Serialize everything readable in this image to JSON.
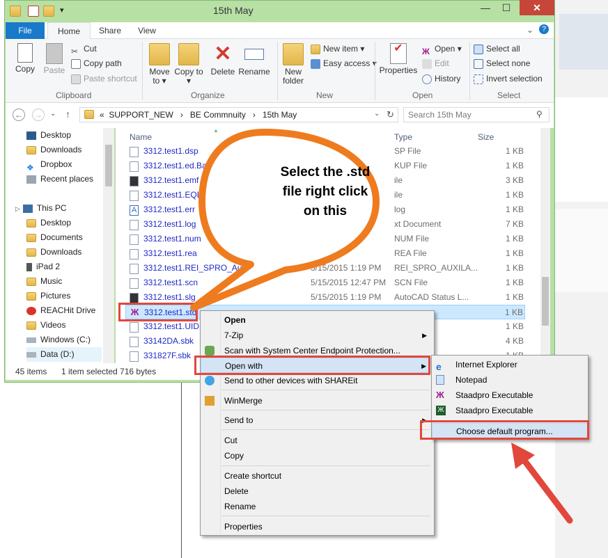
{
  "window": {
    "title": "15th May",
    "minimize": "—",
    "maximize": "☐",
    "close": "✕"
  },
  "ribbon": {
    "tabs": [
      "File",
      "Home",
      "Share",
      "View"
    ],
    "clipboard": {
      "label": "Clipboard",
      "copy": "Copy",
      "paste": "Paste",
      "cut": "Cut",
      "copy_path": "Copy path",
      "paste_shortcut": "Paste shortcut"
    },
    "organize": {
      "label": "Organize",
      "move_to": "Move to ▾",
      "copy_to": "Copy to ▾",
      "delete": "Delete",
      "rename": "Rename"
    },
    "new": {
      "label": "New",
      "new_folder": "New folder",
      "new_item": "New item ▾",
      "easy_access": "Easy access ▾"
    },
    "open": {
      "label": "Open",
      "properties": "Properties",
      "open": "Open ▾",
      "edit": "Edit",
      "history": "History"
    },
    "select": {
      "label": "Select",
      "select_all": "Select all",
      "select_none": "Select none",
      "invert": "Invert selection"
    }
  },
  "address": {
    "crumbs": [
      "«",
      "SUPPORT_NEW",
      "›",
      "BE Commnuity",
      "›",
      "15th May"
    ],
    "search_placeholder": "Search 15th May"
  },
  "nav": {
    "favorites": [
      "Desktop",
      "Downloads",
      "Dropbox",
      "Recent places"
    ],
    "this_pc": "This PC",
    "pc_items": [
      "Desktop",
      "Documents",
      "Downloads",
      "iPad 2",
      "Music",
      "Pictures",
      "REACHit Drive",
      "Videos",
      "Windows (C:)",
      "Data (D:)"
    ]
  },
  "columns": {
    "name": "Name",
    "type": "Type",
    "size": "Size"
  },
  "files": [
    {
      "name": "3312.test1.dsp",
      "date": "",
      "type": "SP File",
      "size": "1 KB"
    },
    {
      "name": "3312.test1.ed.Backup",
      "date": "",
      "type": "KUP File",
      "size": "1 KB"
    },
    {
      "name": "3312.test1.emf",
      "date": "",
      "type": "ile",
      "size": "3 KB"
    },
    {
      "name": "3312.test1.EQL",
      "date": "",
      "type": "ile",
      "size": "1 KB"
    },
    {
      "name": "3312.test1.err",
      "date": "",
      "type": "log",
      "size": "1 KB"
    },
    {
      "name": "3312.test1.log",
      "date": "",
      "type": "xt Document",
      "size": "7 KB"
    },
    {
      "name": "3312.test1.num",
      "date": "",
      "type": "NUM File",
      "size": "1 KB"
    },
    {
      "name": "3312.test1.rea",
      "date": "",
      "type": "REA File",
      "size": "1 KB"
    },
    {
      "name": "3312.test1.REI_SPRO_Auxila",
      "date": "5/15/2015 1:19 PM",
      "type": "REI_SPRO_AUXILA...",
      "size": "1 KB"
    },
    {
      "name": "3312.test1.scn",
      "date": "5/15/2015 12:47 PM",
      "type": "SCN File",
      "size": "1 KB"
    },
    {
      "name": "3312.test1.slg",
      "date": "5/15/2015 1:19 PM",
      "type": "AutoCAD Status L...",
      "size": "1 KB"
    },
    {
      "name": "3312.test1.std",
      "date": "",
      "type": "",
      "size": "1 KB"
    },
    {
      "name": "3312.test1.UID",
      "date": "",
      "type": "",
      "size": "1 KB"
    },
    {
      "name": "33142DA.sbk",
      "date": "",
      "type": "",
      "size": "4 KB"
    },
    {
      "name": "331827F.sbk",
      "date": "",
      "type": "",
      "size": "1 KB"
    }
  ],
  "status": {
    "count": "45 items",
    "selected": "1 item selected  716 bytes"
  },
  "context_menu": {
    "open": "Open",
    "sevenzip": "7-Zip",
    "scan": "Scan with System Center Endpoint Protection...",
    "open_with": "Open with",
    "send_shareit": "Send to other devices with SHAREit",
    "winmerge": "WinMerge",
    "send_to": "Send to",
    "cut": "Cut",
    "copy": "Copy",
    "create_shortcut": "Create shortcut",
    "delete": "Delete",
    "rename": "Rename",
    "properties": "Properties"
  },
  "open_with_menu": {
    "items": [
      "Internet Explorer",
      "Notepad",
      "Staadpro Executable",
      "Staadpro Executable"
    ],
    "choose": "Choose default program..."
  },
  "callout": {
    "line1": "Select the .std",
    "line2": "file right click",
    "line3": "on this"
  },
  "colors": {
    "accent": "#1979ca",
    "highlight_red": "#e2473b",
    "callout_orange": "#ef7b1f",
    "window_frame": "#b7e0a4"
  }
}
